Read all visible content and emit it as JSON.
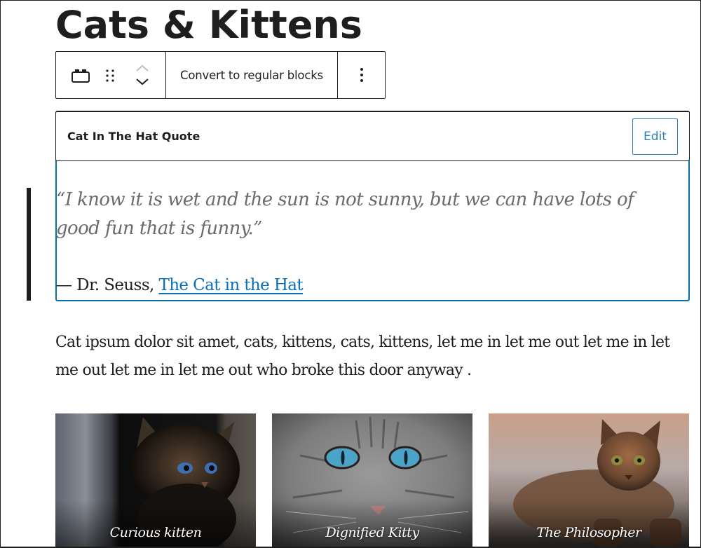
{
  "page": {
    "title": "Cats & Kittens"
  },
  "toolbar": {
    "block_icon": "reusable-block-icon",
    "drag_icon": "drag-handle-icon",
    "move_up_icon": "chevron-up-icon",
    "move_down_icon": "chevron-down-icon",
    "convert_label": "Convert to regular blocks",
    "more_icon": "more-vertical-icon"
  },
  "reusable_block": {
    "title": "Cat In The Hat Quote",
    "edit_label": "Edit",
    "accent_color": "#2c82b9",
    "quote": {
      "text": "“I know it is wet and the sun is not sunny, but we can have lots of good fun that is funny.”",
      "cite_prefix": "— Dr. Seuss, ",
      "cite_link": "The Cat in the Hat",
      "link_color": "#0a6fb8"
    }
  },
  "paragraph": {
    "text": "Cat ipsum dolor sit amet, cats, kittens, cats, kittens, let me in let me out let me in let me out let me in let me out who broke this door anyway ."
  },
  "gallery": {
    "items": [
      {
        "caption": "Curious kitten",
        "image": "kitten-photo"
      },
      {
        "caption": "Dignified Kitty",
        "image": "gray-cat-photo"
      },
      {
        "caption": "The Philosopher",
        "image": "tabby-cat-photo"
      }
    ]
  }
}
